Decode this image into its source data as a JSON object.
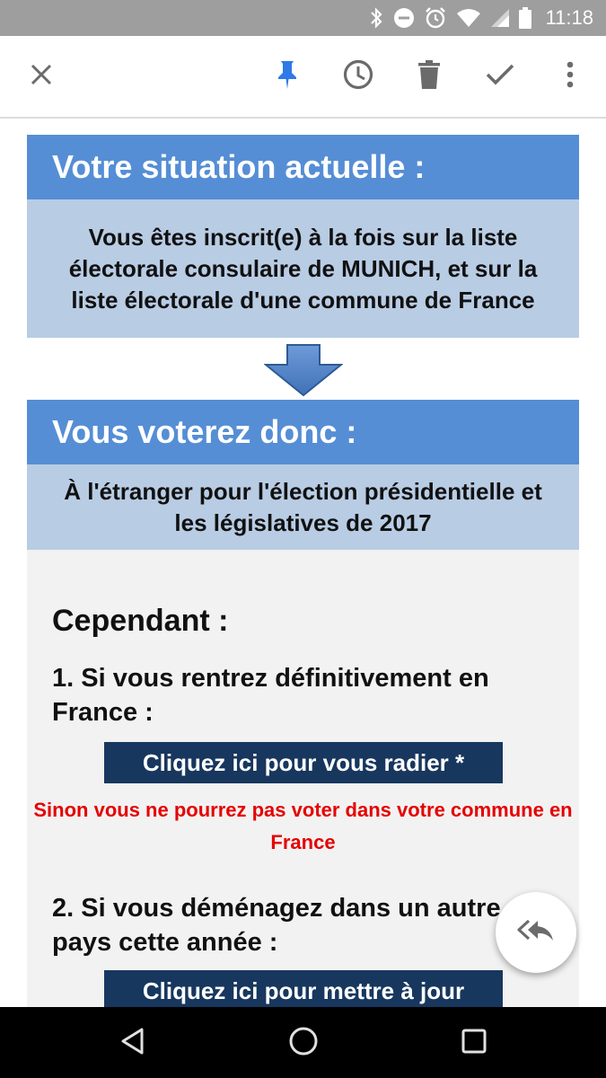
{
  "status_bar": {
    "time": "11:18",
    "icons": [
      "bluetooth-icon",
      "do-not-disturb-icon",
      "alarm-icon",
      "wifi-icon",
      "cell-signal-icon",
      "battery-icon"
    ]
  },
  "toolbar": {
    "icons": [
      "close-icon",
      "pin-icon",
      "clock-icon",
      "trash-icon",
      "check-icon",
      "more-vert-icon"
    ],
    "accent_color": "#2f79e8"
  },
  "section1": {
    "title": "Votre situation actuelle :",
    "body": "Vous êtes inscrit(e) à la fois sur la liste électorale consulaire de MUNICH, et sur la liste électorale d'une commune de France"
  },
  "section2": {
    "title": "Vous voterez donc :",
    "body": "À l'étranger pour l'élection présidentielle et les législatives de 2017"
  },
  "cependant": {
    "heading": "Cependant :",
    "item1": "1. Si vous rentrez définitivement en France :",
    "item1_button": "Cliquez ici pour vous radier *",
    "item1_warning": "Sinon vous ne pourrez pas voter dans votre commune en France",
    "item2": "2. Si vous déménagez dans un autre pays cette année :",
    "item2_button": "Cliquez ici pour mettre à jour"
  },
  "colors": {
    "header_blue": "#558ed5",
    "body_blue": "#b8cce4",
    "button_navy": "#17375e",
    "warning_red": "#e60000"
  },
  "nav_bar": {
    "icons": [
      "back-icon",
      "home-icon",
      "recents-icon"
    ]
  }
}
